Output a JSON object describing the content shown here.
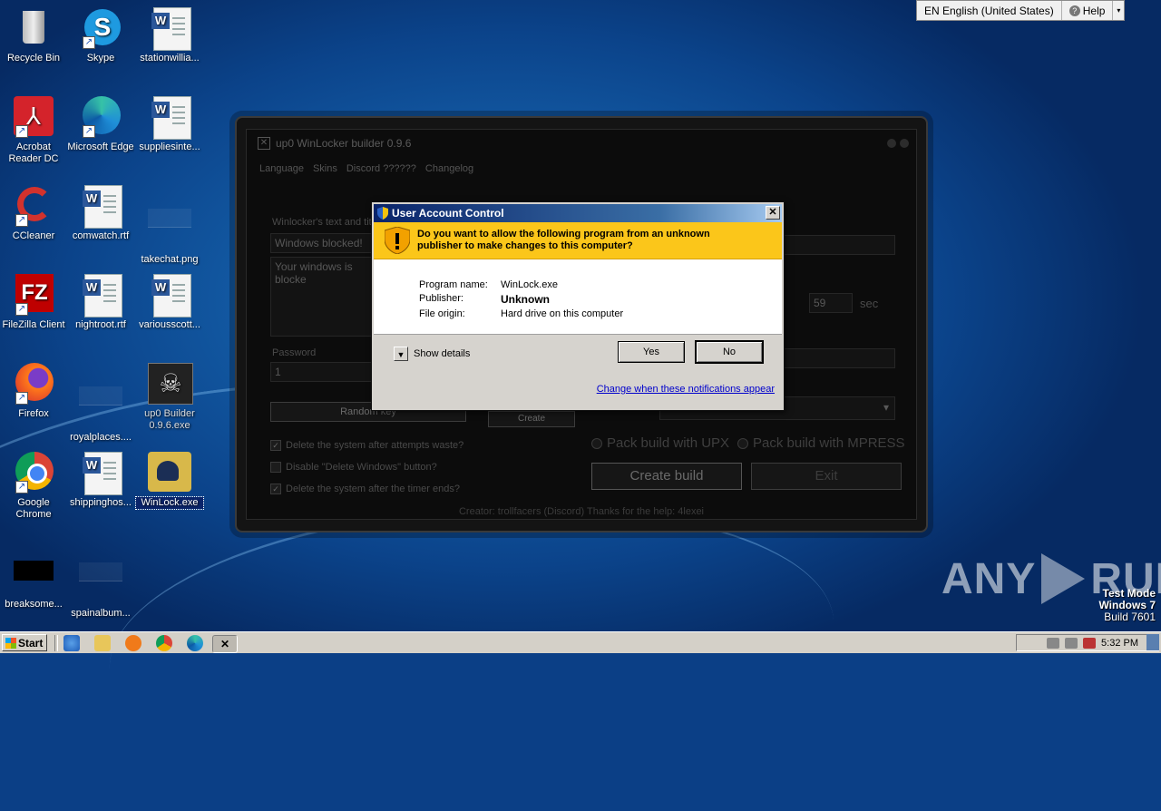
{
  "desktop": {
    "icons": [
      {
        "label": "Recycle Bin"
      },
      {
        "label": "Skype"
      },
      {
        "label": "stationwillia..."
      },
      {
        "label": "Acrobat Reader DC"
      },
      {
        "label": "Microsoft Edge"
      },
      {
        "label": "suppliesinte..."
      },
      {
        "label": "CCleaner"
      },
      {
        "label": "comwatch.rtf"
      },
      {
        "label": "takechat.png"
      },
      {
        "label": "FileZilla Client"
      },
      {
        "label": "nightroot.rtf"
      },
      {
        "label": "variousscott..."
      },
      {
        "label": "Firefox"
      },
      {
        "label": "royalplaces...."
      },
      {
        "label": "up0 Builder 0.9.6.exe"
      },
      {
        "label": "Google Chrome"
      },
      {
        "label": "shippinghos..."
      },
      {
        "label": "WinLock.exe"
      },
      {
        "label": "breaksome..."
      },
      {
        "label": "spainalbum..."
      }
    ]
  },
  "langbar": {
    "language": "EN English (United States)",
    "help": "Help"
  },
  "builder": {
    "title": "up0 WinLocker builder 0.9.6",
    "menu": [
      "Language",
      "Skins",
      "Discord ??????",
      "Changelog"
    ],
    "text_label": "Winlocker's text and tit",
    "title_value": "Windows blocked!",
    "body_value": "Your windows is blocke",
    "timer_value": "59",
    "timer_unit": "sec",
    "password_label": "Password",
    "password_value": "1",
    "random_key": "Random key",
    "create_short": "Create",
    "checks": [
      {
        "label": "Delete the system after attempts waste?",
        "checked": true
      },
      {
        "label": "Disable \"Delete Windows\" button?",
        "checked": false
      },
      {
        "label": "Delete the system after the timer ends?",
        "checked": true
      }
    ],
    "pack_upx": "Pack build with UPX",
    "pack_mpress": "Pack build with MPRESS",
    "create_build": "Create build",
    "exit": "Exit",
    "footer": "Creator: trollfacers (Discord) Thanks for the help: 4lexei"
  },
  "uac": {
    "title": "User Account Control",
    "question": "Do you want to allow the following program from an unknown publisher to make changes to this computer?",
    "program_label": "Program name:",
    "program_value": "WinLock.exe",
    "publisher_label": "Publisher:",
    "publisher_value": "Unknown",
    "origin_label": "File origin:",
    "origin_value": "Hard drive on this computer",
    "show_details": "Show details",
    "yes": "Yes",
    "no": "No",
    "change_link": "Change when these notifications appear"
  },
  "watermark": {
    "brand_left": "ANY",
    "brand_right": "RUN",
    "mode": "Test Mode",
    "os": "Windows 7",
    "build": "Build 7601"
  },
  "taskbar": {
    "start": "Start",
    "clock": "5:32 PM"
  }
}
